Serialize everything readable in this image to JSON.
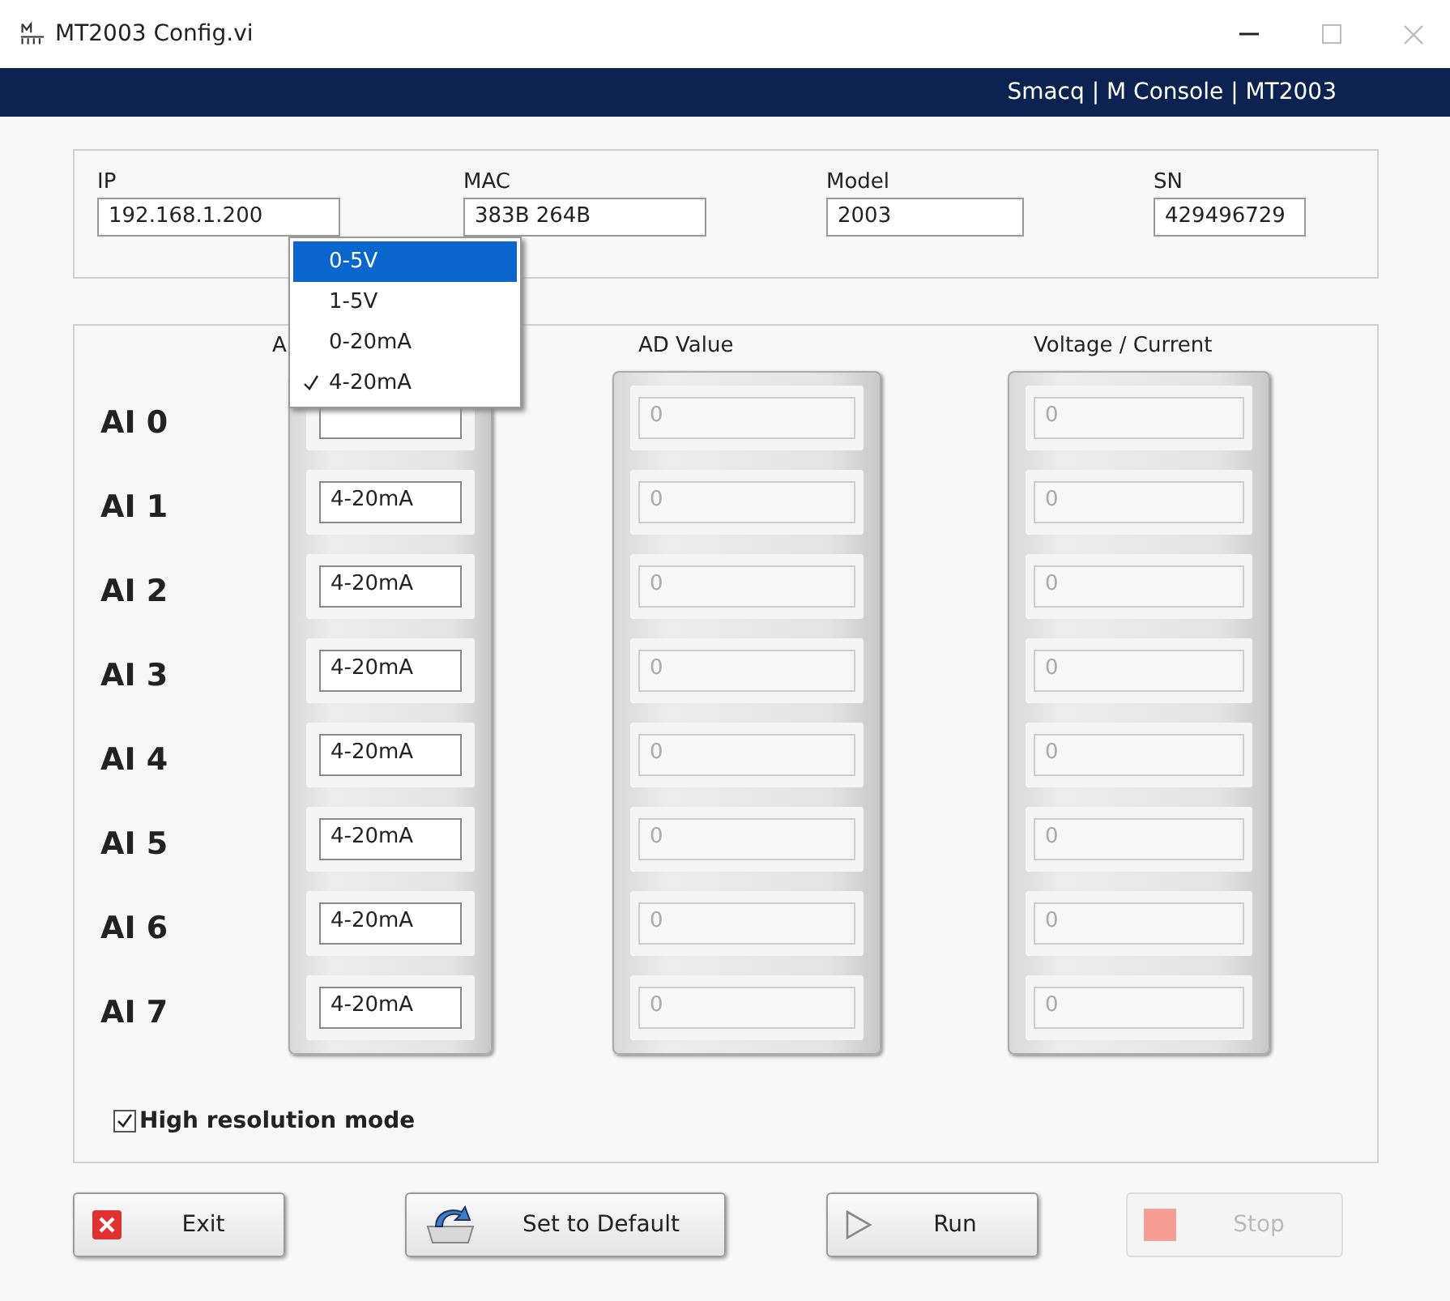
{
  "window": {
    "title": "MT2003 Config.vi",
    "banner": "Smacq | M Console | MT2003"
  },
  "device": [
    {
      "label": "IP",
      "value": "192.168.1.200"
    },
    {
      "label": "MAC",
      "value": "383B 264B"
    },
    {
      "label": "Model",
      "value": "2003"
    },
    {
      "label": "SN",
      "value": "429496729"
    }
  ],
  "columns": [
    "A",
    "AD Value",
    "Voltage / Current"
  ],
  "channels": [
    {
      "name": "AI 0",
      "ad_value": "0",
      "reading": "0"
    },
    {
      "name": "AI 1",
      "range": "4-20mA",
      "ad_value": "0",
      "reading": "0"
    },
    {
      "name": "AI 2",
      "range": "4-20mA",
      "ad_value": "0",
      "reading": "0"
    },
    {
      "name": "AI 3",
      "range": "4-20mA",
      "ad_value": "0",
      "reading": "0"
    },
    {
      "name": "AI 4",
      "range": "4-20mA",
      "ad_value": "0",
      "reading": "0"
    },
    {
      "name": "AI 5",
      "range": "4-20mA",
      "ad_value": "0",
      "reading": "0"
    },
    {
      "name": "AI 6",
      "range": "4-20mA",
      "ad_value": "0",
      "reading": "0"
    },
    {
      "name": "AI 7",
      "range": "4-20mA",
      "ad_value": "0",
      "reading": "0"
    }
  ],
  "range_menu": [
    {
      "label": "0-5V",
      "selected": true,
      "checked": false
    },
    {
      "label": "1-5V",
      "selected": false,
      "checked": false
    },
    {
      "label": "0-20mA",
      "selected": false,
      "checked": false
    },
    {
      "label": "4-20mA",
      "selected": false,
      "checked": true
    }
  ],
  "high_resolution": {
    "label": "High resolution mode",
    "checked": true
  },
  "buttons": [
    {
      "label": "Exit",
      "kind": "exit",
      "disabled": false
    },
    {
      "label": "Set to Default",
      "kind": "default",
      "disabled": false
    },
    {
      "label": "Run",
      "kind": "run",
      "disabled": false
    },
    {
      "label": "Stop",
      "kind": "stop",
      "disabled": true
    }
  ]
}
